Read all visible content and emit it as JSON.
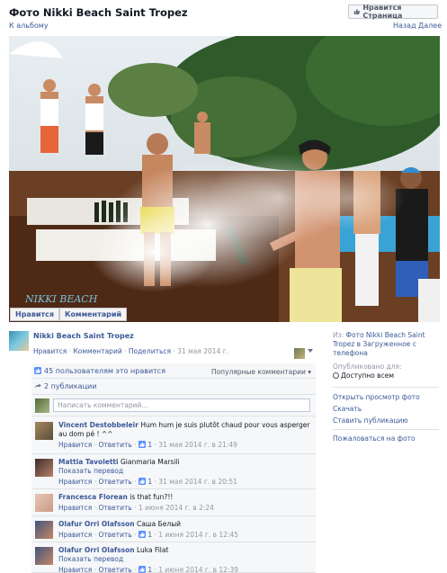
{
  "header": {
    "title": "Фото Nikki Beach Saint Tropez",
    "like_page_label": "Нравится Страница",
    "back_link": "К альбому",
    "prev_label": "Назад",
    "next_label": "Далее"
  },
  "photo": {
    "watermark": "NIKKI BEACH",
    "like_button": "Нравится",
    "comment_button": "Комментарий"
  },
  "owner": {
    "name": "Nikki Beach Saint Tropez",
    "like": "Нравится",
    "comment": "Комментарий",
    "share": "Поделиться",
    "date": "31 мая 2014 г.",
    "separator": "·"
  },
  "ufi": {
    "likes_text": "45 пользователям это нравится",
    "popular_comments": "Популярные комментарии",
    "shares_text": "2 публикации",
    "comment_placeholder": "Написать комментарий..."
  },
  "comments": [
    {
      "author": "Vincent Destobbeleir",
      "text": "Hum hum je suis plutôt chaud pour vous asperger au dom pé ! ^^",
      "translate": "",
      "like": "Нравится",
      "reply": "Ответить",
      "likes": "1",
      "time": "31 мая 2014 г. в 21:49"
    },
    {
      "author": "Mattia Tavoletti",
      "text": "Gianmaria Marsili",
      "translate": "Показать перевод",
      "like": "Нравится",
      "reply": "Ответить",
      "likes": "1",
      "time": "31 мая 2014 г. в 20:51"
    },
    {
      "author": "Francesca Florean",
      "text": "is that fun?!!",
      "translate": "",
      "like": "Нравится",
      "reply": "Ответить",
      "likes": "",
      "time": "1 июня 2014 г. в 2:24"
    },
    {
      "author": "Olafur Orri Olafsson",
      "text": "Саша Белый",
      "translate": "",
      "like": "Нравится",
      "reply": "Ответить",
      "likes": "1",
      "time": "1 июня 2014 г. в 12:45"
    },
    {
      "author": "Olafur Orri Olafsson",
      "text": "Luka Filat",
      "translate": "Показать перевод",
      "like": "Нравится",
      "reply": "Ответить",
      "likes": "1",
      "time": "1 июня 2014 г. в 12:39"
    }
  ],
  "sidebar": {
    "from_label": "Из:",
    "from_text": "Фото Nikki Beach Saint Tropez в Загруженное с телефона",
    "published_label": "Опубликовано для:",
    "audience": "Доступно всем",
    "actions": [
      "Открыть просмотр фото",
      "Скачать",
      "Ставить публикацию"
    ],
    "report": "Пожаловаться на фото"
  },
  "colors": {
    "link": "#3b5998",
    "meta": "#9197a3",
    "ufi_bg": "#f6f7f9"
  }
}
